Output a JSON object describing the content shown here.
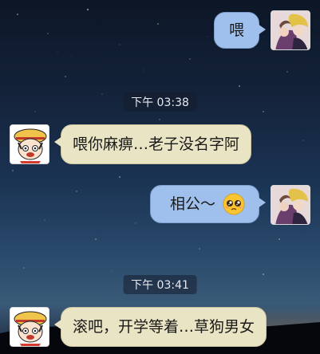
{
  "messages": [
    {
      "side": "right",
      "text": "喂"
    },
    {
      "side": "left",
      "text": "喂你麻痹…老子没名字阿"
    },
    {
      "side": "right",
      "text": "相公～",
      "emoji": "pleading-face-icon"
    },
    {
      "side": "left",
      "text": "滚吧，开学等着…草狗男女"
    }
  ],
  "timestamps": [
    "下午 03:38",
    "下午 03:41"
  ],
  "colors": {
    "right_bubble": "#9fc0ec",
    "left_bubble": "#e9e4c4",
    "timestamp_bg": "#1e2b3c"
  }
}
